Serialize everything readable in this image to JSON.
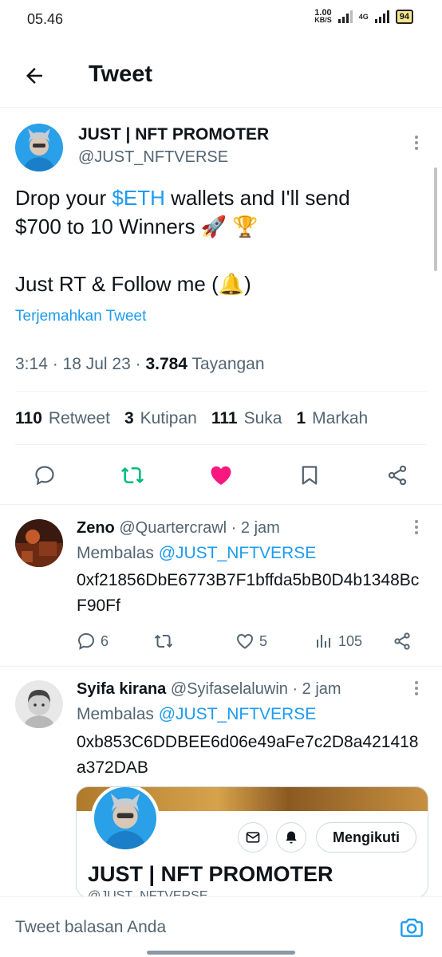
{
  "status_bar": {
    "time": "05.46",
    "net_speed_value": "1.00",
    "net_speed_unit": "KB/S",
    "network_type": "4G",
    "battery": "94"
  },
  "header": {
    "title": "Tweet"
  },
  "tweet": {
    "author_name": "JUST | NFT PROMOTER",
    "author_handle": "@JUST_NFTVERSE",
    "text_line1_pre": "Drop your ",
    "cashtag": "$ETH",
    "text_line1_post": " wallets and I'll send",
    "text_line2": "$700 to 10 Winners 🚀 🏆",
    "text_line3": "Just RT & Follow me (🔔)",
    "translate_label": "Terjemahkan Tweet",
    "meta_time": "3:14 · 18 Jul 23 · ",
    "views_count": "3.784",
    "views_label": " Tayangan",
    "stats": [
      {
        "count": "110",
        "label": "Retweet"
      },
      {
        "count": "3",
        "label": "Kutipan"
      },
      {
        "count": "111",
        "label": "Suka"
      },
      {
        "count": "1",
        "label": "Markah"
      }
    ]
  },
  "replies": [
    {
      "name": "Zeno",
      "handle_time": " @Quartercrawl · 2 jam",
      "reply_prefix": "Membalas ",
      "reply_mention": "@JUST_NFTVERSE",
      "text": "0xf21856DbE6773B7F1bffda5bB0D4b1348BcF90Ff",
      "reply_count": "6",
      "like_count": "5",
      "view_count": "105"
    },
    {
      "name": "Syifa kirana",
      "handle_time": " @Syifaselaluwin · 2 jam",
      "reply_prefix": "Membalas ",
      "reply_mention": "@JUST_NFTVERSE",
      "text": "0xb853C6DDBEE6d06e49aFe7c2D8a421418a372DAB"
    }
  ],
  "card": {
    "follow_label": "Mengikuti",
    "name": "JUST | NFT PROMOTER",
    "handle": "@JUST_NFTVERSE"
  },
  "composer": {
    "placeholder": "Tweet balasan Anda"
  },
  "colors": {
    "accent": "#1d9bf0",
    "retweet_green": "#00ba7c",
    "like_pink": "#f91880",
    "text_secondary": "#536471"
  }
}
